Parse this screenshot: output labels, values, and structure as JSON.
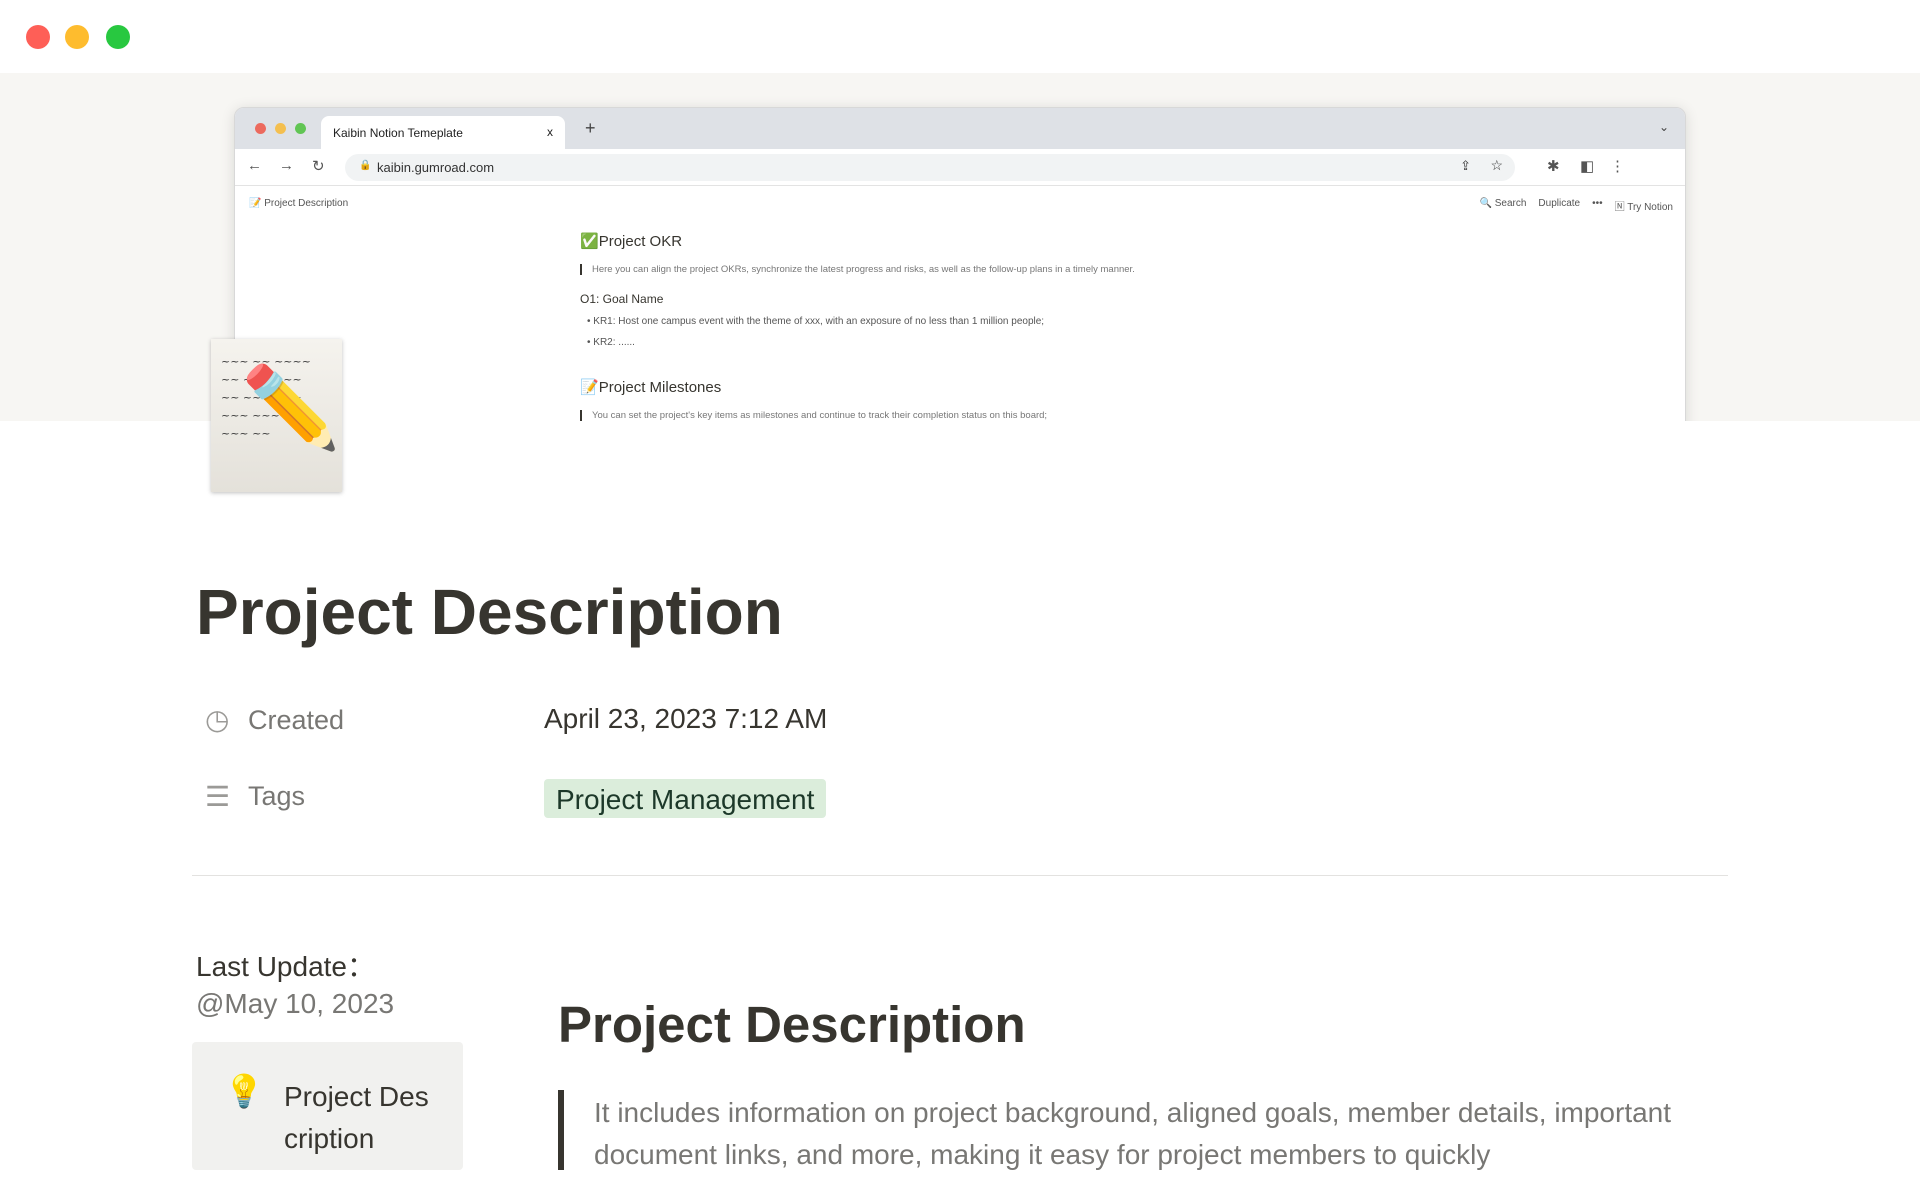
{
  "window": {
    "controls": [
      "close",
      "minimize",
      "maximize"
    ]
  },
  "cover": {
    "browser": {
      "tab_title": "Kaibin Notion Temeplate",
      "tab_close": "x",
      "new_tab": "+",
      "url": "kaibin.gumroad.com",
      "breadcrumb": "Project Description",
      "actions": {
        "search": "Search",
        "duplicate": "Duplicate",
        "more": "•••",
        "try": "Try Notion"
      },
      "content": {
        "okr_heading": "Project OKR",
        "okr_quote": "Here you can align the project OKRs, synchronize the latest progress and risks, as well as the follow-up plans in a timely manner.",
        "goal": "O1: Goal Name",
        "krs": [
          "KR1: Host one campus event with the theme of xxx, with an exposure of no less than 1 million people;",
          "KR2: ......"
        ],
        "milestones_heading": "Project Milestones",
        "milestones_quote": "You can set the project's key items as milestones and continue to track their completion status on this board;"
      }
    }
  },
  "page": {
    "icon": "memo-pencil-icon",
    "title": "Project Description",
    "properties": [
      {
        "label": "Created",
        "icon": "clock-icon",
        "value": "April 23, 2023 7:12 AM"
      },
      {
        "label": "Tags",
        "icon": "list-icon",
        "value": "Project Management",
        "tag_color": "#dbeddb"
      }
    ],
    "last_update_label": "Last Update：",
    "last_update_value": "@May 10, 2023",
    "callout": {
      "icon": "lightbulb-icon",
      "text": "Project Description"
    },
    "heading": "Project Description",
    "quote": "It includes information on project background, aligned goals, member details, important document links, and more, making it easy for project members to quickly"
  }
}
